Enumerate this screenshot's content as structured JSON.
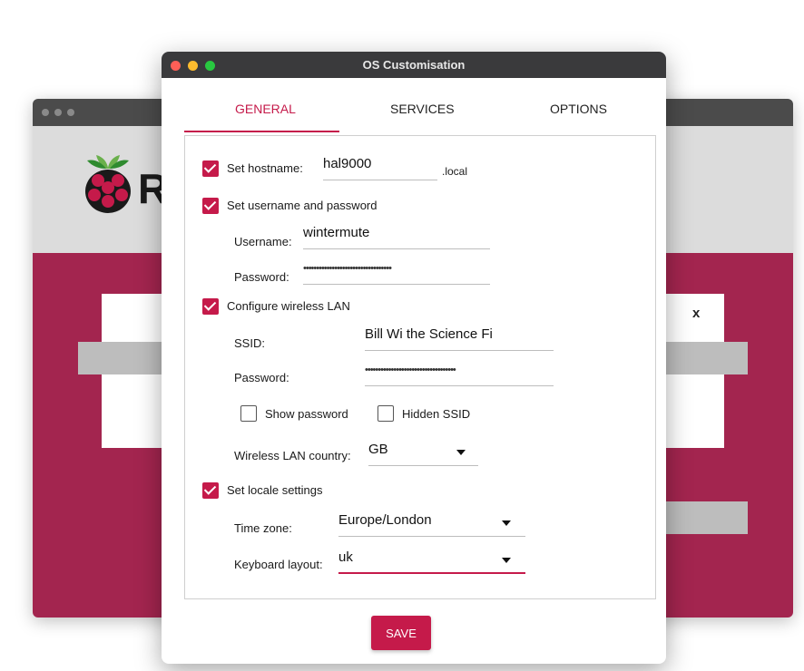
{
  "window": {
    "title": "OS Customisation"
  },
  "background": {
    "app_letter": "R",
    "dialog_close": "x"
  },
  "tabs": [
    {
      "label": "GENERAL",
      "active": true
    },
    {
      "label": "SERVICES",
      "active": false
    },
    {
      "label": "OPTIONS",
      "active": false
    }
  ],
  "hostname": {
    "checked": true,
    "label": "Set hostname:",
    "value": "hal9000",
    "suffix": ".local"
  },
  "user": {
    "checked": true,
    "label": "Set username and password",
    "username_label": "Username:",
    "username": "wintermute",
    "password_label": "Password:",
    "password_mask": "••••••••••••••••••••••••••••••••••"
  },
  "wifi": {
    "checked": true,
    "label": "Configure wireless LAN",
    "ssid_label": "SSID:",
    "ssid": "Bill Wi the Science Fi",
    "password_label": "Password:",
    "password_mask": "•••••••••••••••••••••••••••••••••••",
    "show_password_label": "Show password",
    "show_password_checked": false,
    "hidden_ssid_label": "Hidden SSID",
    "hidden_ssid_checked": false,
    "country_label": "Wireless LAN country:",
    "country": "GB"
  },
  "locale": {
    "checked": true,
    "label": "Set locale settings",
    "timezone_label": "Time zone:",
    "timezone": "Europe/London",
    "keyboard_label": "Keyboard layout:",
    "keyboard": "uk"
  },
  "actions": {
    "save_label": "SAVE"
  },
  "colors": {
    "accent": "#c51a4a",
    "titlebar": "#3a3a3c",
    "background_app": "#a3254f"
  }
}
